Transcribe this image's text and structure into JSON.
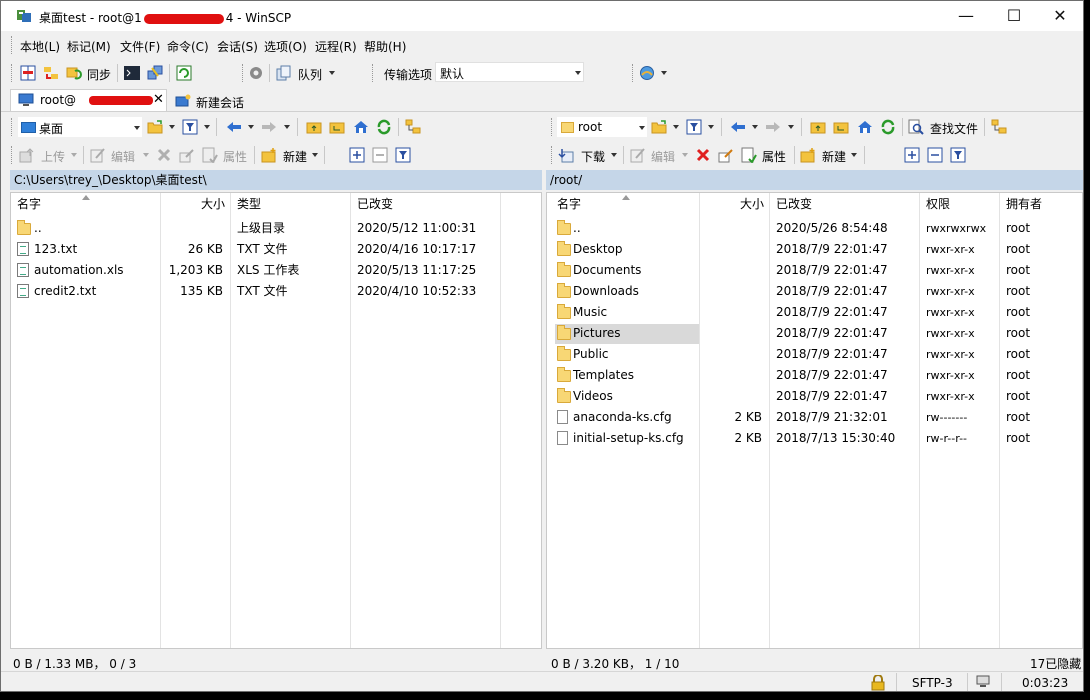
{
  "window": {
    "title_prefix": "桌面test - root@1",
    "title_suffix": "4 - WinSCP",
    "minimize": "—",
    "maximize": "☐",
    "close": "✕"
  },
  "menu": [
    "本地(L)",
    "标记(M)",
    "文件(F)",
    "命令(C)",
    "会话(S)",
    "选项(O)",
    "远程(R)",
    "帮助(H)"
  ],
  "toolbar": {
    "sync_label": "同步",
    "queue_label": "队列",
    "transfer_label": "传输选项",
    "transfer_value": "默认"
  },
  "tabs": {
    "session_label": "root@",
    "new_session_label": "新建会话"
  },
  "left": {
    "location": "桌面",
    "upload_label": "上传",
    "edit_label": "编辑",
    "properties_label": "属性",
    "new_label": "新建",
    "path": "C:\\Users\\trey_\\Desktop\\桌面test\\",
    "columns": {
      "name": "名字",
      "size": "大小",
      "type": "类型",
      "modified": "已改变"
    },
    "files": [
      {
        "name": "..",
        "size": "",
        "type": "上级目录",
        "modified": "2020/5/12   11:00:31",
        "icon": "parent-dir"
      },
      {
        "name": "123.txt",
        "size": "26 KB",
        "type": "TXT 文件",
        "modified": "2020/4/16   10:17:17",
        "icon": "text-file"
      },
      {
        "name": "automation.xls",
        "size": "1,203 KB",
        "type": "XLS 工作表",
        "modified": "2020/5/13   11:17:25",
        "icon": "text-file"
      },
      {
        "name": "credit2.txt",
        "size": "135 KB",
        "type": "TXT 文件",
        "modified": "2020/4/10   10:52:33",
        "icon": "text-file"
      }
    ],
    "status": "0 B / 1.33 MB，  0 / 3"
  },
  "right": {
    "location": "root",
    "download_label": "下载",
    "edit_label": "编辑",
    "properties_label": "属性",
    "new_label": "新建",
    "find_label": "查找文件",
    "path": "/root/",
    "columns": {
      "name": "名字",
      "size": "大小",
      "modified": "已改变",
      "rights": "权限",
      "owner": "拥有者"
    },
    "files": [
      {
        "name": "..",
        "size": "",
        "modified": "2020/5/26  8:54:48",
        "rights": "rwxrwxrwx",
        "owner": "root",
        "icon": "parent-dir"
      },
      {
        "name": "Desktop",
        "size": "",
        "modified": "2018/7/9  22:01:47",
        "rights": "rwxr-xr-x",
        "owner": "root",
        "icon": "folder"
      },
      {
        "name": "Documents",
        "size": "",
        "modified": "2018/7/9  22:01:47",
        "rights": "rwxr-xr-x",
        "owner": "root",
        "icon": "folder"
      },
      {
        "name": "Downloads",
        "size": "",
        "modified": "2018/7/9  22:01:47",
        "rights": "rwxr-xr-x",
        "owner": "root",
        "icon": "folder"
      },
      {
        "name": "Music",
        "size": "",
        "modified": "2018/7/9  22:01:47",
        "rights": "rwxr-xr-x",
        "owner": "root",
        "icon": "folder"
      },
      {
        "name": "Pictures",
        "size": "",
        "modified": "2018/7/9  22:01:47",
        "rights": "rwxr-xr-x",
        "owner": "root",
        "icon": "folder"
      },
      {
        "name": "Public",
        "size": "",
        "modified": "2018/7/9  22:01:47",
        "rights": "rwxr-xr-x",
        "owner": "root",
        "icon": "folder"
      },
      {
        "name": "Templates",
        "size": "",
        "modified": "2018/7/9  22:01:47",
        "rights": "rwxr-xr-x",
        "owner": "root",
        "icon": "folder"
      },
      {
        "name": "Videos",
        "size": "",
        "modified": "2018/7/9  22:01:47",
        "rights": "rwxr-xr-x",
        "owner": "root",
        "icon": "folder"
      },
      {
        "name": "anaconda-ks.cfg",
        "size": "2 KB",
        "modified": "2018/7/9  21:32:01",
        "rights": "rw-------",
        "owner": "root",
        "icon": "file"
      },
      {
        "name": "initial-setup-ks.cfg",
        "size": "2 KB",
        "modified": "2018/7/13  15:30:40",
        "rights": "rw-r--r--",
        "owner": "root",
        "icon": "file"
      }
    ],
    "status": "0 B / 3.20 KB，  1 / 10",
    "hidden": "17已隐藏"
  },
  "statusbar": {
    "protocol": "SFTP-3",
    "elapsed": "0:03:23"
  },
  "colors": {
    "path_bar": "#c5d6e8",
    "selected_row": "#d9d9d9",
    "redaction": "#e01010"
  }
}
